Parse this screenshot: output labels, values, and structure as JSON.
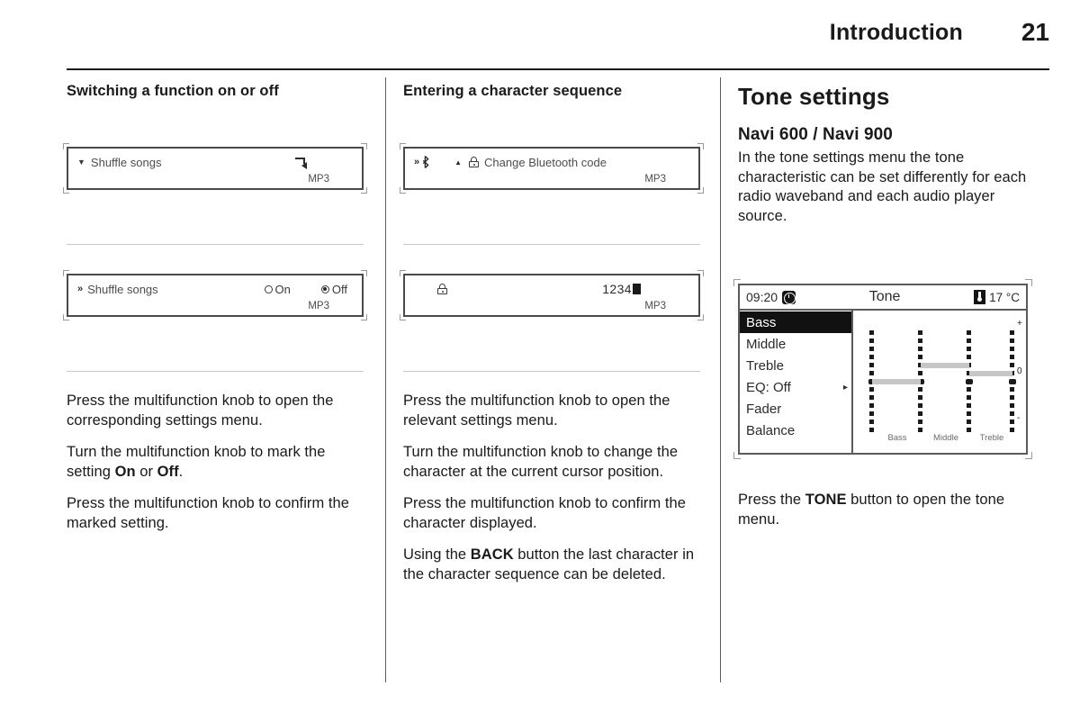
{
  "header": {
    "title": "Introduction",
    "page_number": "21"
  },
  "column1": {
    "heading": "Switching a function on or off",
    "display1": {
      "caret_icon": "caret-down-icon",
      "label": "Shuffle songs",
      "enter_icon": "return-arrow-icon",
      "source": "MP3"
    },
    "display2": {
      "chevron_icon": "double-chevron-right-icon",
      "label": "Shuffle songs",
      "option_on": "On",
      "option_off": "Off",
      "selected": "Off",
      "source": "MP3"
    },
    "paragraphs": [
      "Press the multifunction knob to open the corresponding settings menu.",
      "Turn the multifunction knob to mark the setting On or Off.",
      "Press the multifunction knob to confirm the marked setting."
    ],
    "p2_prefix": "Turn the multifunction knob to mark the setting ",
    "p2_bold1": "On",
    "p2_mid": " or ",
    "p2_bold2": "Off",
    "p2_suffix": "."
  },
  "column2": {
    "heading": "Entering a character sequence",
    "display1": {
      "chevron_icon": "double-chevron-right-icon",
      "bluetooth_icon": "bluetooth-icon",
      "triangle_icon": "triangle-up-icon",
      "lock_icon": "lock-icon",
      "label": "Change Bluetooth code",
      "source": "MP3"
    },
    "display2": {
      "lock_icon": "lock-icon",
      "code_value": "1234",
      "cursor": "block-cursor",
      "source": "MP3"
    },
    "paragraphs": [
      "Press the multifunction knob to open the relevant settings menu.",
      "Turn the multifunction knob to change the character at the current cursor position.",
      "Press the multifunction knob to confirm the character displayed.",
      "Using the BACK button the last character in the character sequence can be deleted."
    ],
    "p4_prefix": "Using the ",
    "p4_bold": "BACK",
    "p4_suffix": " button the last character in the character sequence can be deleted."
  },
  "column3": {
    "heading": "Tone settings",
    "subheading": "Navi 600 / Navi 900",
    "intro": "In the tone settings menu the tone characteristic can be set differently for each radio waveband and each audio player source.",
    "tone_screen": {
      "clock": "09:20",
      "clock_icon": "clock-icon",
      "title": "Tone",
      "temperature": "17 °C",
      "temp_icon": "thermometer-icon",
      "menu_items": [
        {
          "label": "Bass",
          "selected": true,
          "arrow": ""
        },
        {
          "label": "Middle",
          "selected": false,
          "arrow": ""
        },
        {
          "label": "Treble",
          "selected": false,
          "arrow": ""
        },
        {
          "label": "EQ:  Off",
          "selected": false,
          "arrow": "▸"
        },
        {
          "label": "Fader",
          "selected": false,
          "arrow": ""
        },
        {
          "label": "Balance",
          "selected": false,
          "arrow": ""
        }
      ],
      "graph_labels": [
        "Bass",
        "Middle",
        "Treble"
      ],
      "scale_marks": {
        "top": "+",
        "middle": "0",
        "bottom": "–"
      }
    },
    "footer_paragraph": "Press the TONE button to open the tone menu.",
    "footer_prefix": "Press the ",
    "footer_bold": "TONE",
    "footer_suffix": " button to open the tone menu."
  },
  "chart_data": {
    "type": "bar",
    "title": "Tone",
    "categories": [
      "Bass",
      "Middle",
      "Treble"
    ],
    "values": [
      0,
      2,
      1
    ],
    "ylim": [
      -6,
      6
    ],
    "ylabel": "",
    "xlabel": "",
    "scale_top": "+",
    "scale_zero": "0",
    "scale_bottom": "-",
    "grid": false,
    "legend": "none",
    "dots_per_column": 13
  }
}
